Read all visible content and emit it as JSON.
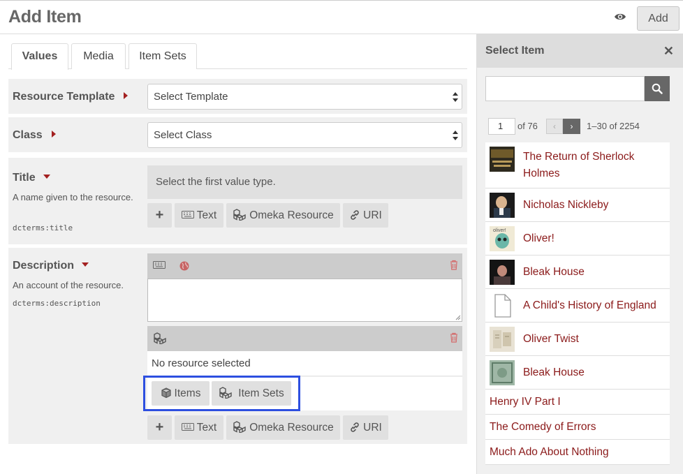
{
  "header": {
    "title": "Add Item",
    "add_label": "Add"
  },
  "tabs": [
    {
      "label": "Values"
    },
    {
      "label": "Media"
    },
    {
      "label": "Item Sets"
    }
  ],
  "resource_template": {
    "label": "Resource Template",
    "select_value": "Select Template"
  },
  "class_field": {
    "label": "Class",
    "select_value": "Select Class"
  },
  "title_field": {
    "label": "Title",
    "description": "A name given to the resource.",
    "term": "dcterms:title",
    "hint": "Select the first value type."
  },
  "value_buttons": {
    "text": "Text",
    "omeka": "Omeka Resource",
    "uri": "URI"
  },
  "description_field": {
    "label": "Description",
    "description": "An account of the resource.",
    "term": "dcterms:description",
    "no_resource": "No resource selected",
    "items_label": "Items",
    "item_sets_label": "Item Sets"
  },
  "sidebar": {
    "title": "Select Item",
    "search_placeholder": "",
    "page_value": "1",
    "page_of": "of 76",
    "range": "1–30 of 2254",
    "items": [
      {
        "title_line1": "The Return of Sherlock",
        "title_line2": "Holmes"
      },
      {
        "title_line1": "Nicholas Nickleby"
      },
      {
        "title_line1": "Oliver!"
      },
      {
        "title_line1": "Bleak House"
      },
      {
        "title_line1": "A Child's History of England"
      },
      {
        "title_line1": "Oliver Twist"
      },
      {
        "title_line1": "Bleak House"
      },
      {
        "title_line1": "Henry IV Part I"
      },
      {
        "title_line1": "The Comedy of Errors"
      },
      {
        "title_line1": "Much Ado About Nothing"
      }
    ]
  },
  "colors": {
    "accent": "#a32020",
    "link": "#8b1a1a",
    "highlight": "#2d4fe0"
  }
}
